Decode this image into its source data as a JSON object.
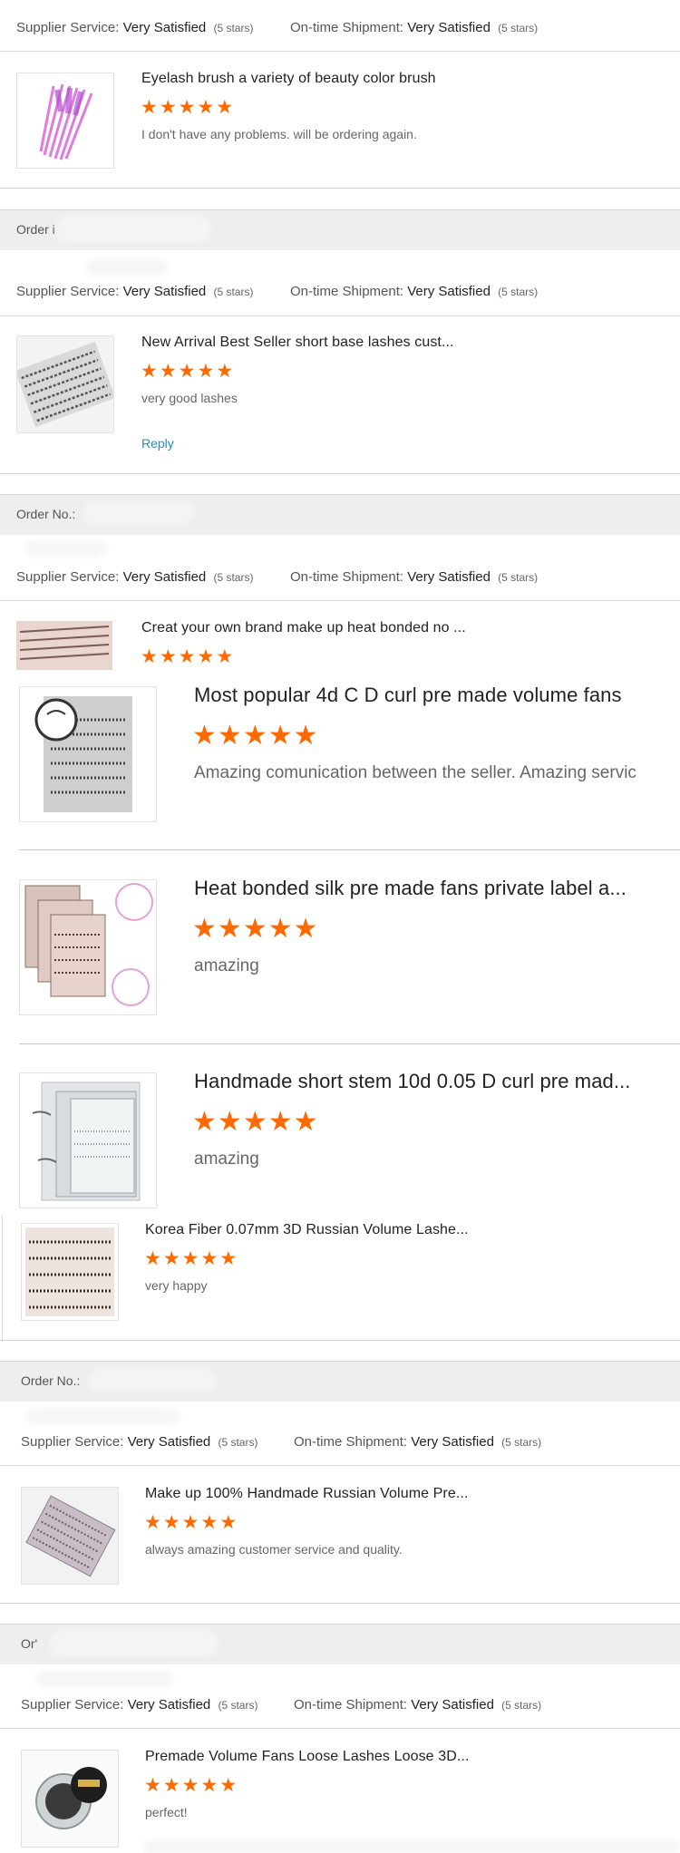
{
  "labels": {
    "supplier": "Supplier Service:",
    "shipment": "On-time Shipment:",
    "satisfied": "Very Satisfied",
    "five_stars": "(5 stars)",
    "reply": "Reply",
    "order_no": "Order No.:",
    "order_trunc1": "Order i",
    "order_no2": "Order No.:",
    "order_trunc2": "Or'"
  },
  "star_glyph": "★",
  "accent_color": "#ff6a00",
  "link_color": "#1a8fc9",
  "reviews": [
    {
      "title": "Eyelash brush a variety of beauty color brush",
      "rating": 5,
      "comment": "I don't have any problems. will be ordering again.",
      "icon": "pink-brush-image"
    },
    {
      "title": "New Arrival Best Seller short base lashes cust...",
      "rating": 5,
      "comment": "very good lashes",
      "icon": "lash-tray-image"
    },
    {
      "title": "Creat your own brand make up heat bonded no ...",
      "rating": 5,
      "comment": "",
      "icon": "lash-strip-image"
    },
    {
      "title": "Most popular 4d C D curl pre made volume fans",
      "rating": 5,
      "comment": "Amazing comunication between the seller. Amazing servic",
      "icon": "volume-fan-tray-image"
    },
    {
      "title": "Heat bonded silk pre made fans private label a...",
      "rating": 5,
      "comment": "amazing",
      "icon": "private-label-box-image"
    },
    {
      "title": "Handmade short stem 10d 0.05 D curl pre mad...",
      "rating": 5,
      "comment": "amazing",
      "icon": "short-stem-tray-image"
    },
    {
      "title": "Korea Fiber 0.07mm 3D Russian Volume Lashe...",
      "rating": 5,
      "comment": "very happy",
      "icon": "russian-volume-tray-image"
    },
    {
      "title": "Make up 100% Handmade Russian Volume Pre...",
      "rating": 5,
      "comment": "always amazing customer service and quality.",
      "icon": "purple-lash-tray-image"
    },
    {
      "title": "Premade Volume Fans Loose Lashes Loose 3D...",
      "rating": 5,
      "comment": "perfect!",
      "icon": "loose-lash-jar-image"
    }
  ]
}
